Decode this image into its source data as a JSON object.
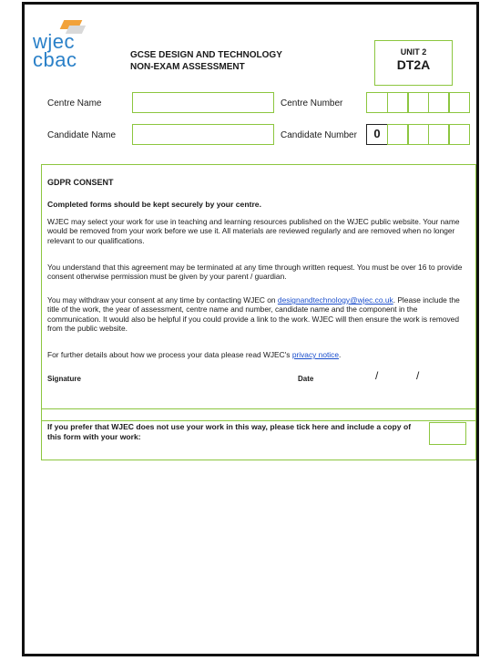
{
  "logo": {
    "line1": "wjec",
    "line2": "cbac"
  },
  "header": {
    "title_line1": "GCSE DESIGN AND TECHNOLOGY",
    "title_line2": "NON-EXAM ASSESSMENT",
    "unit_label": "UNIT 2",
    "unit_code": "DT2A"
  },
  "fields": {
    "centre_name_label": "Centre Name",
    "centre_number_label": "Centre Number",
    "candidate_name_label": "Candidate Name",
    "candidate_number_label": "Candidate Number",
    "centre_name_value": "",
    "candidate_name_value": "",
    "centre_number_cells": [
      "",
      "",
      "",
      "",
      ""
    ],
    "candidate_number_cells": [
      "0",
      "",
      "",
      "",
      ""
    ]
  },
  "gdpr": {
    "title": "GDPR CONSENT",
    "subtitle": "Completed forms should be kept securely by your centre.",
    "para1": "WJEC may select your work for use in teaching and learning resources published on the WJEC public website.  Your name would be removed from your work before we use it.  All materials are reviewed regularly and are removed when no longer relevant to our qualifications.",
    "para2": "You understand that this agreement may be terminated at any time through written request.  You must be over 16 to provide consent otherwise permission must be given by your parent / guardian.",
    "para3_prefix": "You may withdraw your consent at any time by contacting WJEC on ",
    "email": "designandtechnology@wjec.co.uk",
    "para3_suffix": ".  Please include the title of the work, the year of assessment, centre name and number, candidate name and the component in the communication.  It would also be helpful if you could provide a link to the work.  WJEC will then ensure the work is removed from the public website.",
    "para4_prefix": "For further details about how we process your data please read WJEC's ",
    "privacy_link": "privacy notice",
    "para4_suffix": ".",
    "signature_label": "Signature",
    "date_label": "Date",
    "date_sep1": "/",
    "date_sep2": "/"
  },
  "optout": {
    "text": "If you prefer that WJEC does not use your work in this way, please tick here and include a copy of this form with your work:"
  },
  "colors": {
    "accent_green": "#8cc63f",
    "logo_blue": "#2a80c8",
    "logo_orange": "#f2a23a",
    "link_blue": "#1a4ecc"
  }
}
